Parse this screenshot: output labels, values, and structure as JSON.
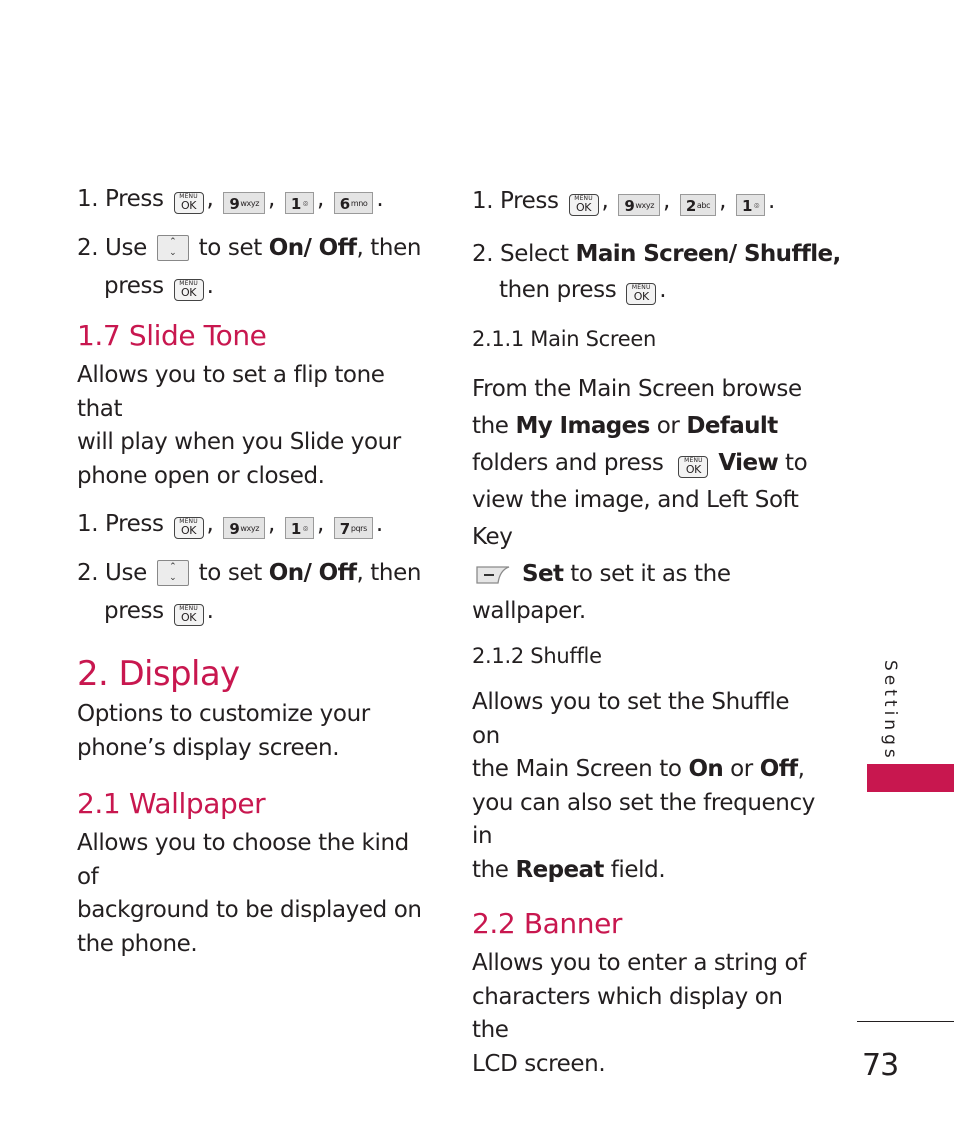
{
  "sidebar": {
    "section_tab": "Settings",
    "accent_color": "#c8174f"
  },
  "page_number": "73",
  "left_column": {
    "steps_a": {
      "step1": {
        "prefix": "1. Press",
        "keys": [
          "MENU OK",
          "9 wxyz",
          "1 voicemail",
          "6 mno"
        ]
      },
      "step2": {
        "prefix": "2. Use",
        "middle": "to set",
        "bold": "On/ Off",
        "suffix": ", then",
        "cont": "press"
      }
    },
    "section_17": {
      "heading": "1.7 Slide Tone",
      "body": "Allows you to set a flip tone that will play when you Slide your phone open or closed.",
      "lines": [
        "Allows you to set a flip tone that",
        "will play when you Slide your",
        "phone open or closed."
      ],
      "step1": {
        "prefix": "1. Press",
        "keys": [
          "MENU OK",
          "9 wxyz",
          "1 voicemail",
          "7 pqrs"
        ]
      },
      "step2": {
        "prefix": "2. Use",
        "middle": "to set",
        "bold": "On/ Off",
        "suffix": ", then",
        "cont": "press"
      }
    },
    "section_2": {
      "heading": "2. Display",
      "lines": [
        "Options to customize your",
        "phone’s display screen."
      ]
    },
    "section_21": {
      "heading": "2.1 Wallpaper",
      "lines": [
        "Allows you to choose the kind of",
        "background to be displayed on",
        "the phone."
      ]
    }
  },
  "right_column": {
    "step1": {
      "prefix": "1. Press",
      "keys": [
        "MENU OK",
        "9 wxyz",
        "2 abc",
        "1 voicemail"
      ]
    },
    "step2": {
      "prefix": "2. Select",
      "bold": "Main Screen/ Shuffle,",
      "cont": "then press"
    },
    "section_211": {
      "heading": "2.1.1 Main Screen",
      "l1": "From the Main  Screen browse",
      "l2_a": "the",
      "l2_b": "My Images",
      "l2_c": "or",
      "l2_d": "Default",
      "l3_a": "folders and press",
      "l3_b": "View",
      "l3_c": "to",
      "l4": "view the image, and Left Soft Key",
      "l5_b": "Set",
      "l5_c": "to set it as the",
      "l6": "wallpaper."
    },
    "section_212": {
      "heading": "2.1.2 Shuffle",
      "l1": "Allows you to set the Shuffle on",
      "l2_a": "the Main Screen to",
      "l2_b": "On",
      "l2_c": "or",
      "l2_d": "Off",
      "l2_e": ",",
      "l3": "you can also set the frequency in",
      "l4_a": "the",
      "l4_b": "Repeat",
      "l4_c": "field."
    },
    "section_22": {
      "heading": "2.2 Banner",
      "lines": [
        "Allows you to enter a string of",
        "characters which display on the",
        "LCD screen."
      ]
    }
  },
  "keys": {
    "menu_top": "MENU",
    "menu_bottom": "OK",
    "k9": {
      "digit": "9",
      "letters": "wxyz"
    },
    "k1": {
      "digit": "1",
      "letters": "⌾"
    },
    "k6": {
      "digit": "6",
      "letters": "mno"
    },
    "k7": {
      "digit": "7",
      "letters": "pqrs"
    },
    "k2": {
      "digit": "2",
      "letters": "abc"
    },
    "nav_up": "⌃",
    "nav_down": "⌄",
    "comma": ",",
    "period": "."
  }
}
